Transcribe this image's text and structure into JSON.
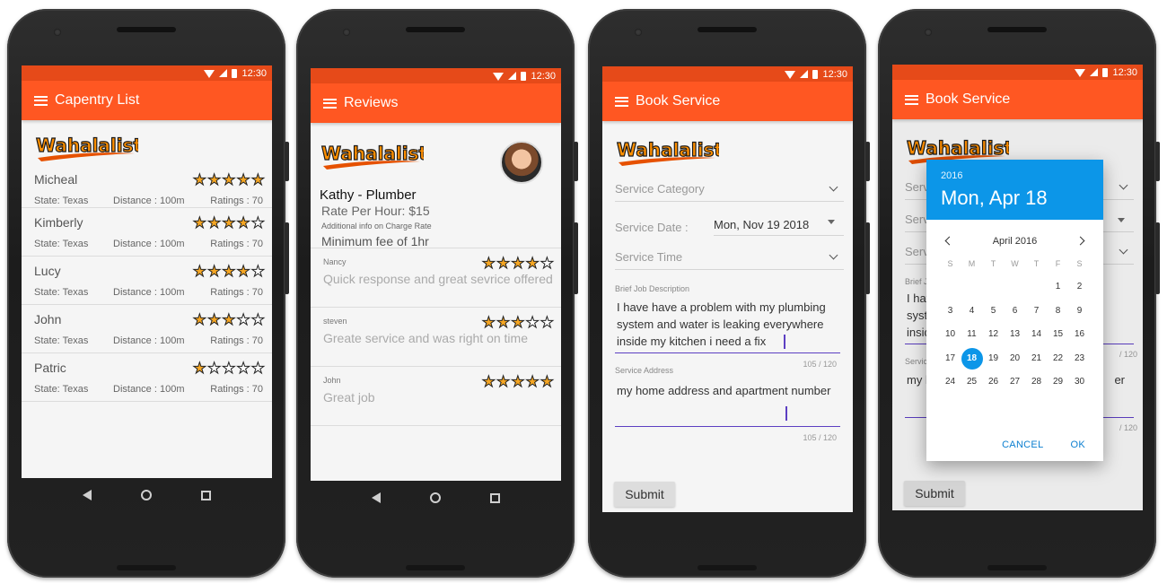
{
  "status_time": "12:30",
  "logo_text": "Wahalalist",
  "screen1": {
    "title": "Capentry List",
    "items": [
      {
        "name": "Micheal",
        "state": "State: Texas",
        "distance": "Distance : 100m",
        "ratings": "Ratings : 70",
        "stars": 5
      },
      {
        "name": "Kimberly",
        "state": "State: Texas",
        "distance": "Distance : 100m",
        "ratings": "Ratings : 70",
        "stars": 4
      },
      {
        "name": "Lucy",
        "state": "State: Texas",
        "distance": "Distance : 100m",
        "ratings": "Ratings : 70",
        "stars": 4
      },
      {
        "name": "John",
        "state": "State: Texas",
        "distance": "Distance : 100m",
        "ratings": "Ratings : 70",
        "stars": 3
      },
      {
        "name": "Patric",
        "state": "State: Texas",
        "distance": "Distance : 100m",
        "ratings": "Ratings : 70",
        "stars": 1
      }
    ]
  },
  "screen2": {
    "title": "Reviews",
    "name": "Kathy - Plumber",
    "rate": "Rate Per Hour: $15",
    "info_label": "Additional info on Charge Rate",
    "min_fee": "Minimum fee of 1hr",
    "reviews": [
      {
        "author": "Nancy",
        "text": "Quick response and great sevrice offered",
        "stars": 4
      },
      {
        "author": "steven",
        "text": "Greate service and was right on time",
        "stars": 3
      },
      {
        "author": "John",
        "text": "Great job",
        "stars": 5
      }
    ]
  },
  "screen3": {
    "title": "Book Service",
    "category_placeholder": "Service Category",
    "date_label": "Service Date :",
    "date_value": "Mon, Nov 19 2018",
    "time_placeholder": "Service Time",
    "desc_label": "Brief Job Description",
    "desc_lines": [
      "I have have a problem with my plumbing",
      "system and water is leaking  everywhere",
      "inside my kitchen i need a fix"
    ],
    "desc_counter": "105 / 120",
    "addr_label": "Service Address",
    "addr_value": "my home address and apartment number",
    "addr_counter": "105 / 120",
    "submit": "Submit"
  },
  "screen4": {
    "title": "Book Service",
    "bg_partial": {
      "serv1": "Serv",
      "serv2": "Serv",
      "serv3": "Serv",
      "brief": "Brief J",
      "l1": "I hav",
      "l2": "syst",
      "l3": "insid",
      "addr": "Servic",
      "addr_val": "my l",
      "addr_tail": "er",
      "c1": "/ 120",
      "c2": "/ 120"
    },
    "submit": "Submit",
    "dialog": {
      "year": "2016",
      "date": "Mon, Apr 18",
      "month": "April 2016",
      "weekdays": [
        "S",
        "M",
        "T",
        "W",
        "T",
        "F",
        "S"
      ],
      "weeks": [
        [
          "",
          "",
          "",
          "",
          "",
          "1",
          "2"
        ],
        [
          "3",
          "4",
          "5",
          "6",
          "7",
          "8",
          "9"
        ],
        [
          "10",
          "11",
          "12",
          "13",
          "14",
          "15",
          "16"
        ],
        [
          "17",
          "18",
          "19",
          "20",
          "21",
          "22",
          "23"
        ],
        [
          "24",
          "25",
          "26",
          "27",
          "28",
          "29",
          "30"
        ]
      ],
      "selected": "18",
      "cancel": "CANCEL",
      "ok": "OK"
    }
  },
  "colors": {
    "appbar": "#ff5722",
    "statusbar": "#e64a19",
    "accent": "#0c96e8",
    "star": "#f5a623"
  }
}
